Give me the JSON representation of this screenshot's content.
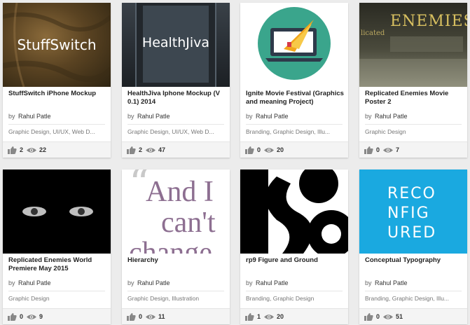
{
  "colors": {
    "card_bg": "#ffffff",
    "page_bg": "#ececec",
    "stats_bg": "#f4f4f4",
    "ignite_green": "#3aa58c",
    "typo_cyan": "#1aa9e0",
    "hierarchy_purple": "#8d6f91"
  },
  "projects": [
    {
      "title": "StuffSwitch iPhone Mockup",
      "by": "by",
      "author": "Rahul Patle",
      "fields": "Graphic Design, UI/UX, Web D...",
      "appreciations": "2",
      "views": "22",
      "thumb_text": "StuffSwitch"
    },
    {
      "title": "HealthJiva Iphone Mockup (V 0.1) 2014",
      "by": "by",
      "author": "Rahul Patle",
      "fields": "Graphic Design, UI/UX, Web D...",
      "appreciations": "2",
      "views": "47",
      "thumb_text": "HealthJiva"
    },
    {
      "title": "Ignite Movie Festival (Graphics and meaning Project)",
      "by": "by",
      "author": "Rahul Patle",
      "fields": "Branding, Graphic Design, Illu...",
      "appreciations": "0",
      "views": "20"
    },
    {
      "title": "Replicated Enemies Movie Poster 2",
      "by": "by",
      "author": "Rahul Patle",
      "fields": "Graphic Design",
      "appreciations": "0",
      "views": "7",
      "thumb_text": "ENEMIES",
      "thumb_text_small": "licated"
    },
    {
      "title": "Replicated Enemies World Premiere May 2015",
      "by": "by",
      "author": "Rahul Patle",
      "fields": "Graphic Design",
      "appreciations": "0",
      "views": "9"
    },
    {
      "title": "Hierarchy",
      "by": "by",
      "author": "Rahul Patle",
      "fields": "Graphic Design, Illustration",
      "appreciations": "0",
      "views": "11",
      "thumb_quote": "“",
      "thumb_line1": "And I",
      "thumb_line2": "can't",
      "thumb_line3": "change"
    },
    {
      "title": "rp9 Figure and Ground",
      "by": "by",
      "author": "Rahul Patle",
      "fields": "Branding, Graphic Design",
      "appreciations": "1",
      "views": "20"
    },
    {
      "title": "Conceptual Typography",
      "by": "by",
      "author": "Rahul Patle",
      "fields": "Branding, Graphic Design, Illu...",
      "appreciations": "0",
      "views": "51",
      "thumb_line1": "RECO",
      "thumb_line2": "NFIG",
      "thumb_line3": "URED"
    }
  ],
  "icons": {
    "appreciate": "thumbs-up-icon",
    "views": "eye-icon"
  }
}
